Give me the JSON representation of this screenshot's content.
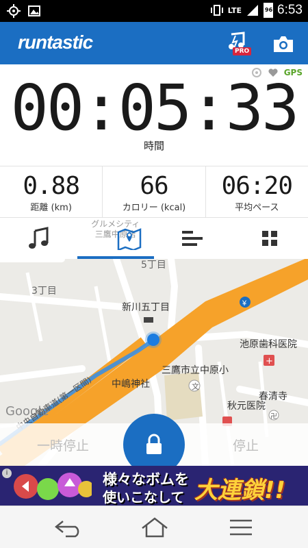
{
  "status_bar": {
    "network": "LTE",
    "battery": "96",
    "time": "6:53"
  },
  "app": {
    "logo": "runtastic",
    "pro_badge": "PRO"
  },
  "session": {
    "gps_label": "GPS",
    "duration": "00:05:33",
    "duration_label": "時間"
  },
  "stats": [
    {
      "value": "0.88",
      "label": "距離 (km)"
    },
    {
      "value": "66",
      "label": "カロリー (kcal)"
    },
    {
      "value": "06:20",
      "label": "平均ペース"
    }
  ],
  "tabs": {
    "map_overlay_line1": "グルメシティ",
    "map_overlay_line2": "三鷹中原店"
  },
  "map": {
    "labels": {
      "block5": "5丁目",
      "block3": "3丁目",
      "shinkawa": "新川五丁目",
      "ikehara": "池原歯科医院",
      "school": "三鷹市立中原小",
      "shrine": "中嶋神社",
      "akimoto": "秋元医院",
      "shunseiji": "春清寺",
      "road": "中央自動車道(第一区間)",
      "google": "Google"
    }
  },
  "controls": {
    "pause_label": "一時停止",
    "stop_label": "停止"
  },
  "ad": {
    "line1": "様々なボムを",
    "line2": "使いこなして",
    "big": "大連鎖!!",
    "info": "i"
  },
  "colors": {
    "primary": "#1b6ec2",
    "route": "#f6a22a",
    "gps": "#5aa52a"
  }
}
